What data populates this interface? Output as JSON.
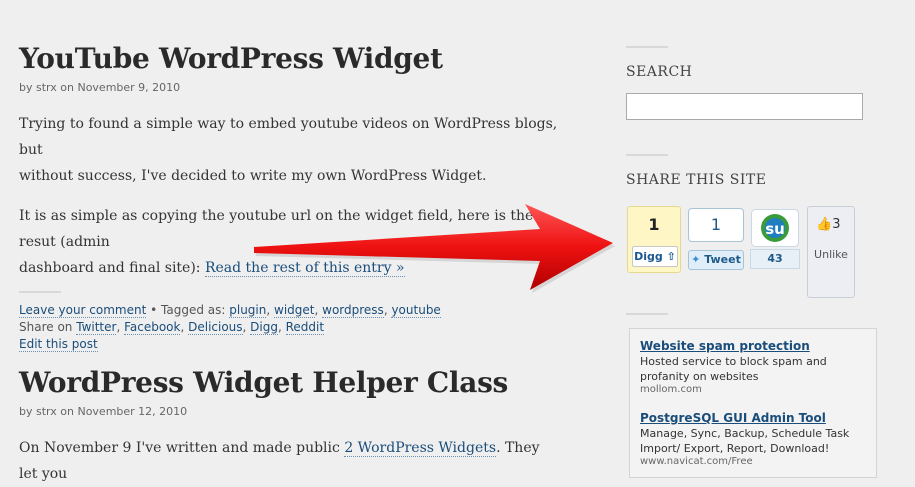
{
  "posts": [
    {
      "title": "YouTube WordPress Widget",
      "meta_by": "by strx on November 9, 2010",
      "para1_line1": "Trying to found a simple way to embed youtube videos on WordPress blogs, but",
      "para1_line2": "without success, I've decided to write my own WordPress Widget.",
      "para2_line1": "It is as simple as copying the youtube url on the widget field, here is the resut (admin",
      "para2_line2_prefix": "dashboard and final site): ",
      "read_more": "Read the rest of this entry »",
      "footer": {
        "leave_comment": "Leave your comment",
        "tagged_as": " • Tagged as: ",
        "tags": [
          "plugin",
          "widget",
          "wordpress",
          "youtube"
        ],
        "share_on": "Share on ",
        "share_links": [
          "Twitter",
          "Facebook",
          "Delicious",
          "Digg",
          "Reddit"
        ],
        "edit": "Edit this post"
      }
    },
    {
      "title": "WordPress Widget Helper Class",
      "meta_by": "by strx on November 12, 2010",
      "para1_prefix": "On November 9 I've written and made public ",
      "para1_link": "2 WordPress Widgets",
      "para1_suffix": ". They let you"
    }
  ],
  "sidebar": {
    "search_title": "SEARCH",
    "search_value": "",
    "share_title": "SHARE THIS SITE",
    "digg": {
      "count": "1",
      "button": "Digg"
    },
    "tweet": {
      "count": "1",
      "button": "Tweet"
    },
    "stumble": {
      "count": "43"
    },
    "facebook": {
      "count": "3",
      "label": "Unlike"
    },
    "ads": [
      {
        "title": "Website spam protection",
        "text_line1": "Hosted service to block spam and",
        "text_line2": "profanity on websites",
        "url": "mollom.com"
      },
      {
        "title": "PostgreSQL GUI Admin Tool",
        "text_line1": "Manage, Sync, Backup, Schedule Task",
        "text_line2": "Import/ Export, Report, Download!",
        "url": "www.navicat.com/Free"
      }
    ]
  },
  "colors": {
    "arrow": "#ee1111",
    "link": "#1a4d7a",
    "background": "#efefef"
  }
}
